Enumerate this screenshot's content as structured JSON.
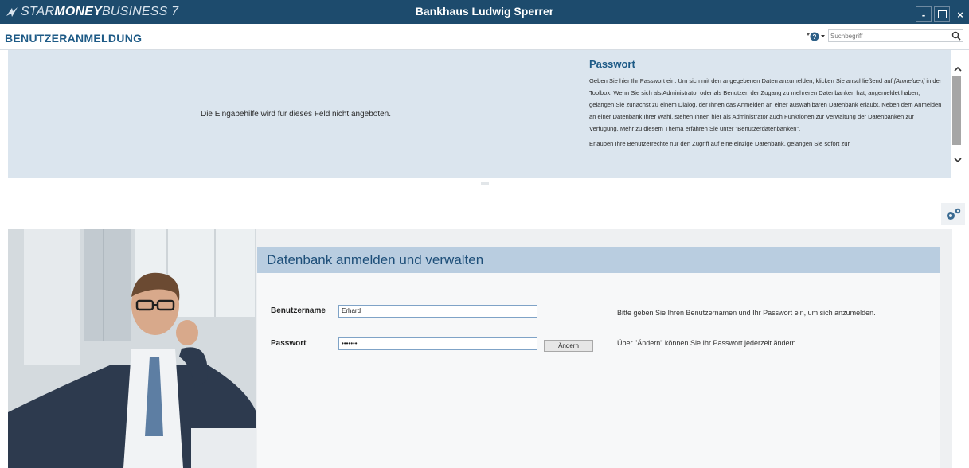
{
  "titlebar": {
    "brand_light": "STAR",
    "brand_bold": "MONEY",
    "brand_rest": " BUSINESS 7",
    "window_title": "Bankhaus Ludwig Sperrer",
    "minimize": "-",
    "close": "×"
  },
  "header": {
    "page_title": "BENUTZERANMELDUNG",
    "search_placeholder": "Suchbegriff"
  },
  "help": {
    "left_text": "Die Eingabehilfe wird für dieses Feld nicht angeboten.",
    "heading": "Passwort",
    "paragraph1_a": "Geben Sie hier Ihr Passwort ein. Um sich mit den angegebenen Daten anzumelden, klicken Sie anschließend auf ",
    "paragraph1_link": "[Anmelden]",
    "paragraph1_b": " in der Toolbox. Wenn Sie sich als Administrator oder als Benutzer, der Zugang zu mehreren Datenbanken hat, angemeldet haben, gelangen Sie zunächst zu einem Dialog, der Ihnen das Anmelden an einer auswählbaren Datenbank erlaubt. Neben dem Anmelden an einer Datenbank Ihrer Wahl, stehen Ihnen hier als Administrator auch Funktionen zur Verwaltung der Datenbanken zur Verfügung. Mehr zu diesem Thema erfahren Sie unter \"Benutzerdatenbanken\".",
    "paragraph2": "Erlauben Ihre Benutzerrechte nur den Zugriff auf eine einzige Datenbank, gelangen Sie sofort zur"
  },
  "panel": {
    "title": "Datenbank anmelden und verwalten",
    "username_label": "Benutzername",
    "username_value": "Erhard",
    "password_label": "Passwort",
    "password_value": "•••••••",
    "change_button": "Ändern",
    "hint_login": "Bitte geben Sie Ihren Benutzernamen und Ihr Passwort ein, um sich anzumelden.",
    "hint_change": "Über \"Ändern\" können Sie Ihr Passwort jederzeit ändern."
  },
  "colors": {
    "titlebar": "#1d4b6d",
    "accent_text": "#1d5a86",
    "help_bg": "#dbe5ee",
    "panel_header": "#b9cde0"
  },
  "icons": [
    "logo-icon",
    "help-icon",
    "search-icon",
    "chevron-up-icon",
    "chevron-down-icon",
    "splitter-grip-icon",
    "settings-gears-icon",
    "minimize-icon",
    "maximize-icon",
    "close-icon"
  ]
}
